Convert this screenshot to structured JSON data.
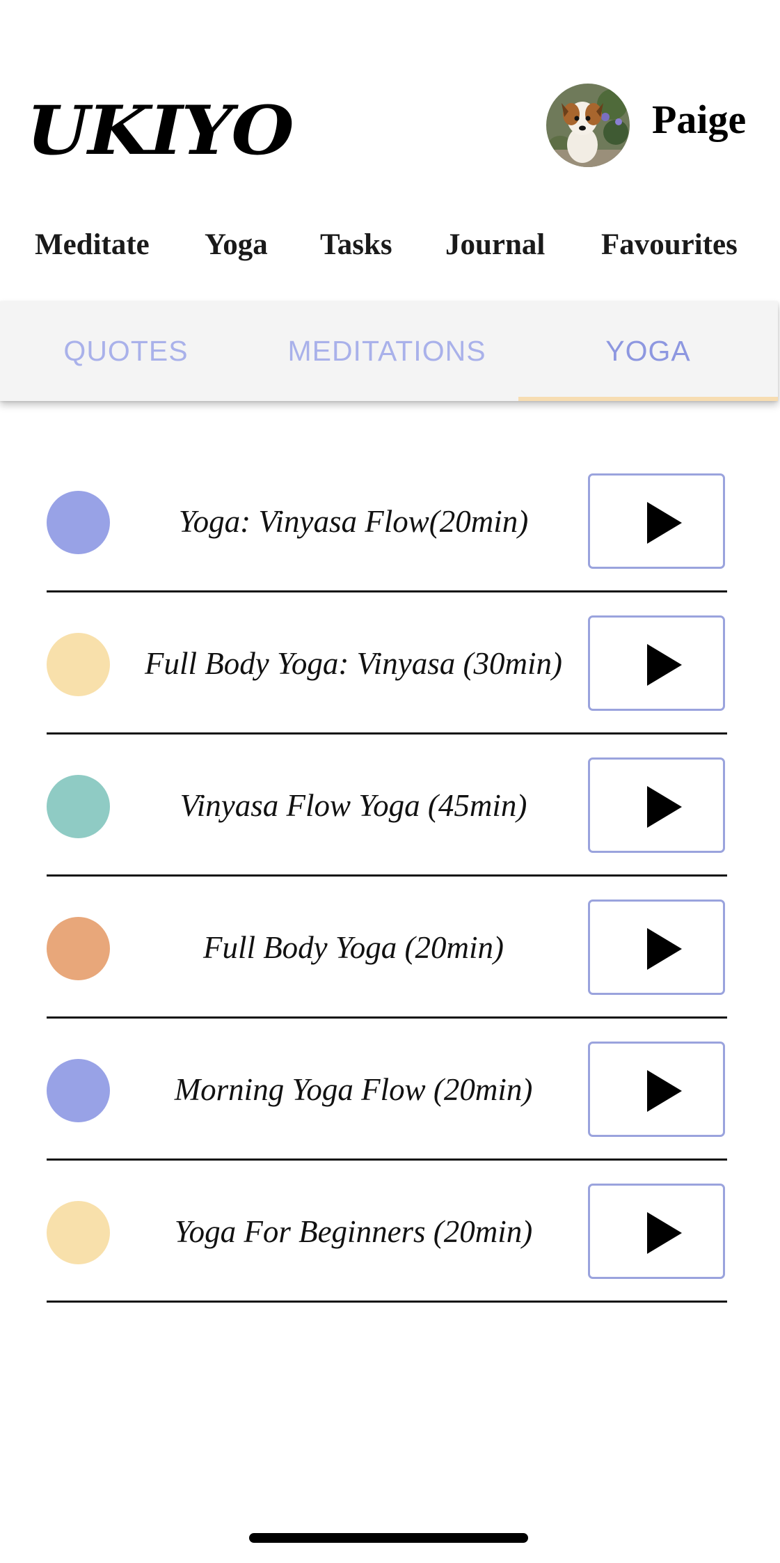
{
  "app": {
    "logo": "UKIYO",
    "user_name": "Paige"
  },
  "main_nav": [
    {
      "label": "Meditate"
    },
    {
      "label": "Yoga"
    },
    {
      "label": "Tasks"
    },
    {
      "label": "Journal"
    },
    {
      "label": "Favourites"
    }
  ],
  "tabs": [
    {
      "label": "QUOTES",
      "active": false
    },
    {
      "label": "MEDITATIONS",
      "active": false
    },
    {
      "label": "YOGA",
      "active": true
    }
  ],
  "colors": {
    "periwinkle": "#98a2e6",
    "peach": "#f8e0ab",
    "teal": "#8fcbc4",
    "orange": "#e8a77a",
    "tab_text": "#a9b1ea",
    "tab_indicator": "#f7ddb2",
    "button_border": "#9aa3dd"
  },
  "sessions": [
    {
      "title": "Yoga: Vinyasa Flow(20min)",
      "color": "#98a2e6",
      "action_icon": "play-icon"
    },
    {
      "title": "Full Body Yoga: Vinyasa (30min)",
      "color": "#f8e0ab",
      "action_icon": "play-icon"
    },
    {
      "title": "Vinyasa Flow Yoga (45min)",
      "color": "#8fcbc4",
      "action_icon": "play-icon"
    },
    {
      "title": "Full Body Yoga (20min)",
      "color": "#e8a77a",
      "action_icon": "play-icon"
    },
    {
      "title": "Morning Yoga Flow (20min)",
      "color": "#98a2e6",
      "action_icon": "play-icon"
    },
    {
      "title": "Yoga For Beginners (20min)",
      "color": "#f8e0ab",
      "action_icon": "play-icon"
    }
  ]
}
